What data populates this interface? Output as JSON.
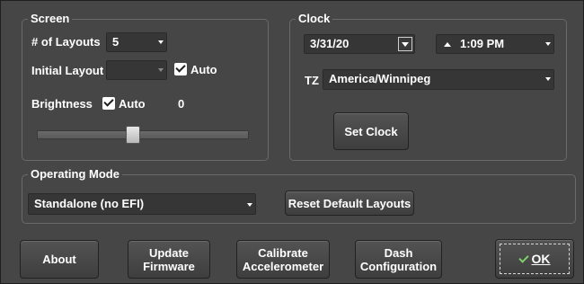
{
  "screen": {
    "title": "Screen",
    "layouts_label": "# of Layouts",
    "layouts_value": "5",
    "initial_layout_label": "Initial Layout",
    "initial_layout_value": "",
    "auto_label": "Auto",
    "auto_checked": true,
    "brightness_label": "Brightness",
    "brightness_auto_label": "Auto",
    "brightness_auto_checked": true,
    "brightness_value": "0",
    "brightness_level_fraction": 0.45
  },
  "clock": {
    "title": "Clock",
    "date_value": "3/31/20",
    "time_value": "1:09 PM",
    "tz_label": "TZ",
    "tz_value": "America/Winnipeg",
    "set_clock_label": "Set Clock"
  },
  "operating_mode": {
    "title": "Operating Mode",
    "mode_value": "Standalone (no EFI)",
    "reset_label": "Reset Default Layouts"
  },
  "buttons": {
    "about": "About",
    "update_firmware": "Update\nFirmware",
    "calibrate": "Calibrate\nAccelerometer",
    "dash_config": "Dash\nConfiguration",
    "ok": "OK"
  },
  "colors": {
    "background": "#464646",
    "field": "#363636",
    "ok_icon": "#7dcf6a"
  }
}
